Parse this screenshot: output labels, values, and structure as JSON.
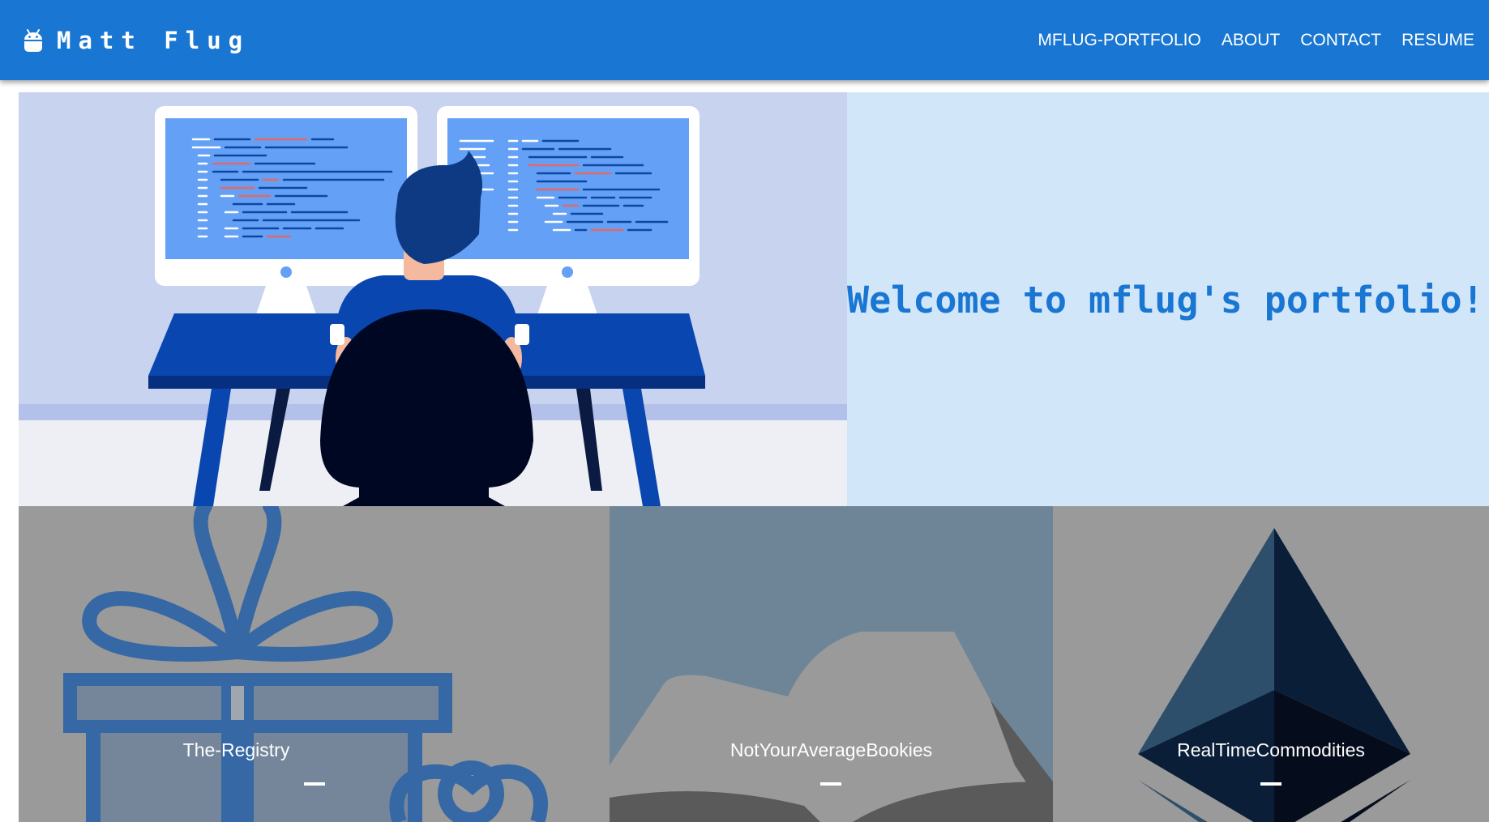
{
  "brand": {
    "name": "Matt Flug",
    "icon": "android-icon"
  },
  "nav": {
    "links": [
      {
        "label": "MFLUG-PORTFOLIO"
      },
      {
        "label": "ABOUT"
      },
      {
        "label": "CONTACT"
      },
      {
        "label": "RESUME"
      }
    ]
  },
  "hero": {
    "title": "Welcome to mflug's portfolio!",
    "illustration": "developer-at-two-monitors-illustration"
  },
  "projects": [
    {
      "title": "The-Registry",
      "image": "gift-box-icon"
    },
    {
      "title": "NotYourAverageBookies",
      "image": "open-book-icon"
    },
    {
      "title": "RealTimeCommodities",
      "image": "ethereum-icon"
    }
  ],
  "colors": {
    "primary": "#1976d2",
    "hero_panel": "#d2e6fa",
    "card_gray": "#9a9a9a",
    "card_slate": "#6e8598"
  }
}
